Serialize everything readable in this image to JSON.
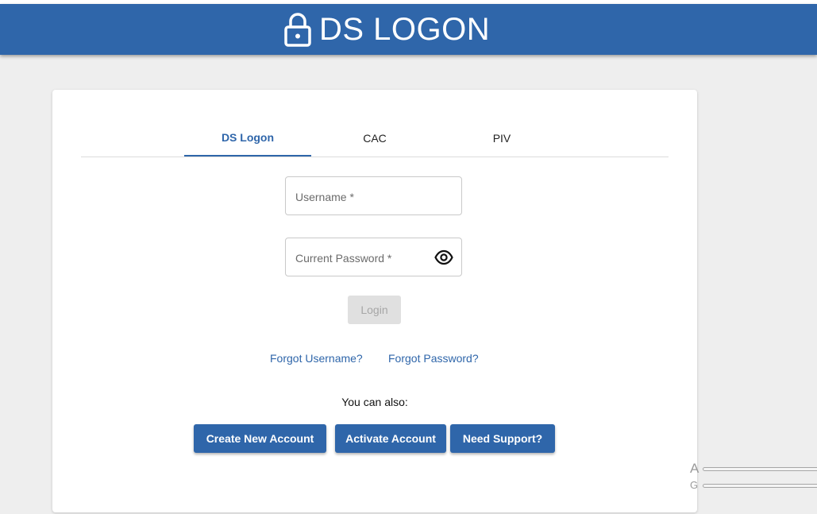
{
  "header": {
    "title": "DS LOGON",
    "icon": "lock-icon",
    "color": "#2f66aa"
  },
  "tabs": [
    {
      "label": "DS Logon",
      "active": true
    },
    {
      "label": "CAC",
      "active": false
    },
    {
      "label": "PIV",
      "active": false
    }
  ],
  "form": {
    "username_placeholder": "Username *",
    "password_placeholder": "Current Password *",
    "password_toggle_icon": "eye-icon",
    "login_label": "Login"
  },
  "links": {
    "forgot_username": "Forgot Username?",
    "forgot_password": "Forgot Password?"
  },
  "also_text": "You can also:",
  "actions": {
    "create": "Create New Account",
    "activate": "Activate Account",
    "support": "Need Support?"
  },
  "overlay": {
    "line1": "A",
    "line2": "G"
  }
}
